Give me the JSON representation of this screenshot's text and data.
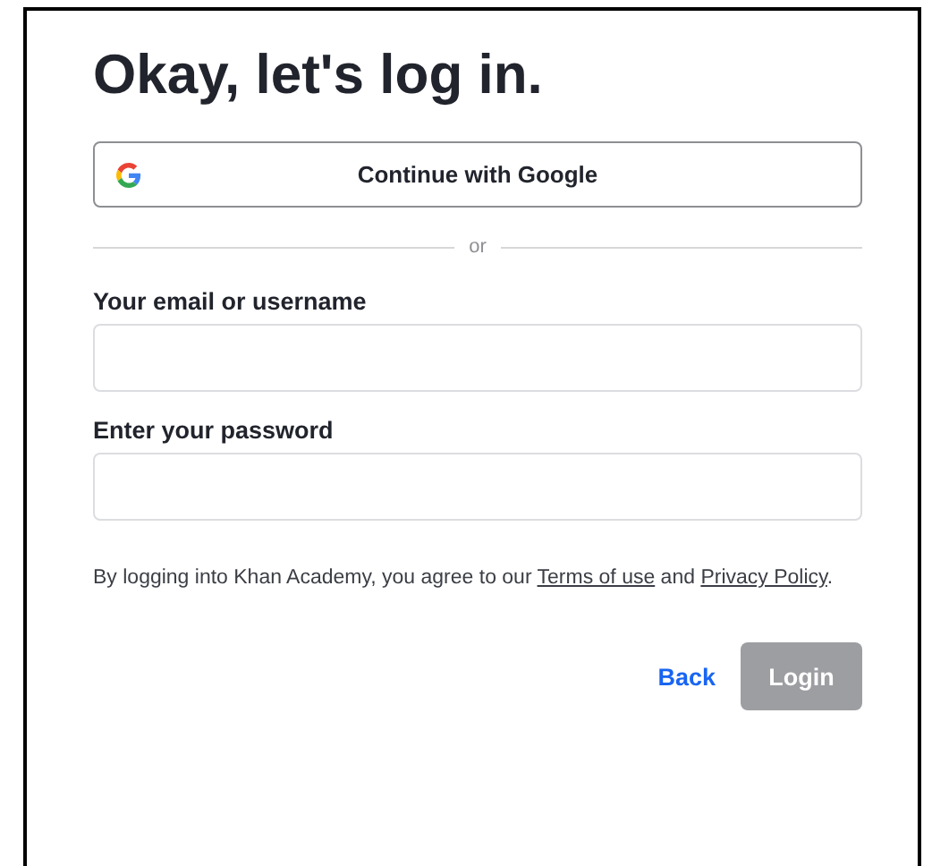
{
  "title": "Okay, let's log in.",
  "google_button": {
    "label": "Continue with Google"
  },
  "divider": {
    "label": "or"
  },
  "fields": [
    {
      "label": "Your email or username"
    },
    {
      "label": "Enter your password"
    }
  ],
  "agreement": [
    {
      "kind": "text",
      "text": "By logging into Khan Academy, you agree to our "
    },
    {
      "kind": "link",
      "text": "Terms of use"
    },
    {
      "kind": "text",
      "text": " and "
    },
    {
      "kind": "link",
      "text": "Privacy Policy"
    },
    {
      "kind": "text",
      "text": "."
    }
  ],
  "buttons": [
    {
      "kind": "link",
      "label": "Back",
      "disabled": false
    },
    {
      "kind": "primary",
      "label": "Login",
      "disabled": true
    }
  ]
}
